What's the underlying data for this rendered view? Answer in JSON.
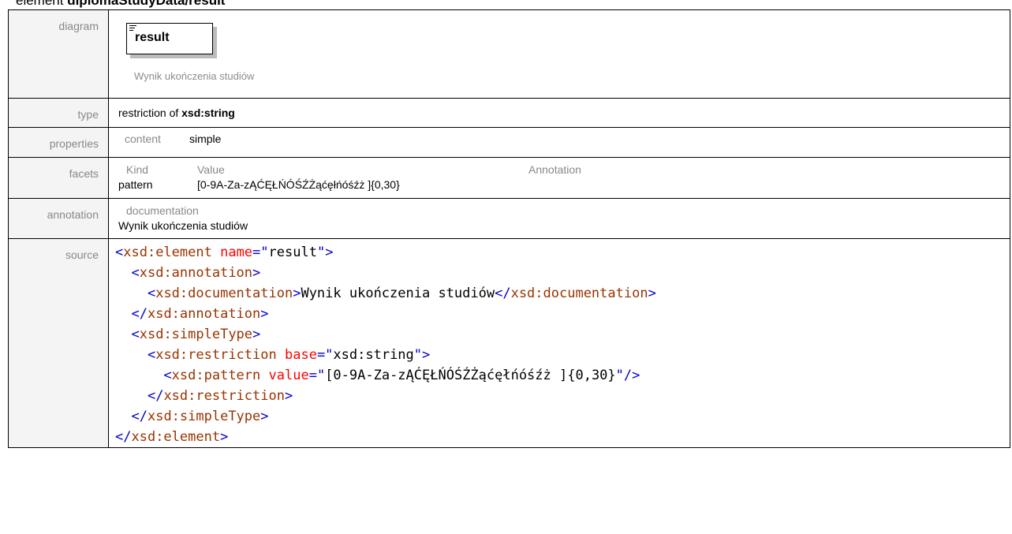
{
  "heading": {
    "prefix": "element ",
    "path": "diplomaStudyData/result"
  },
  "labels": {
    "diagram": "diagram",
    "type": "type",
    "properties": "properties",
    "facets": "facets",
    "annotation": "annotation",
    "source": "source"
  },
  "diagram": {
    "element_name": "result",
    "caption": "Wynik ukończenia studiów"
  },
  "type": {
    "prefix": "restriction of ",
    "base": "xsd:string"
  },
  "properties": {
    "key": "content",
    "value": "simple"
  },
  "facets": {
    "headers": [
      "Kind",
      "Value",
      "Annotation"
    ],
    "rows": [
      {
        "kind": "pattern",
        "value": "[0-9A-Za-zĄĆĘŁŃÓŚŹŻąćęłńóśźż ]{0,30}",
        "annotation": ""
      }
    ]
  },
  "annotation": {
    "header": "documentation",
    "text": "Wynik ukończenia studiów"
  },
  "source": {
    "l1_tag": "xsd:element",
    "l1_attr": "name",
    "l1_val": "result",
    "l2_tag": "xsd:annotation",
    "l3_tag": "xsd:documentation",
    "l3_text": "Wynik ukończenia studiów",
    "l4_tag": "xsd:annotation",
    "l5_tag": "xsd:simpleType",
    "l6_tag": "xsd:restriction",
    "l6_attr": "base",
    "l6_val": "xsd:string",
    "l7_tag": "xsd:pattern",
    "l7_attr": "value",
    "l7_val": "[0-9A-Za-zĄĆĘŁŃÓŚŹŻąćęłńóśźż ]{0,30}",
    "l8_tag": "xsd:restriction",
    "l9_tag": "xsd:simpleType",
    "l10_tag": "xsd:element"
  }
}
